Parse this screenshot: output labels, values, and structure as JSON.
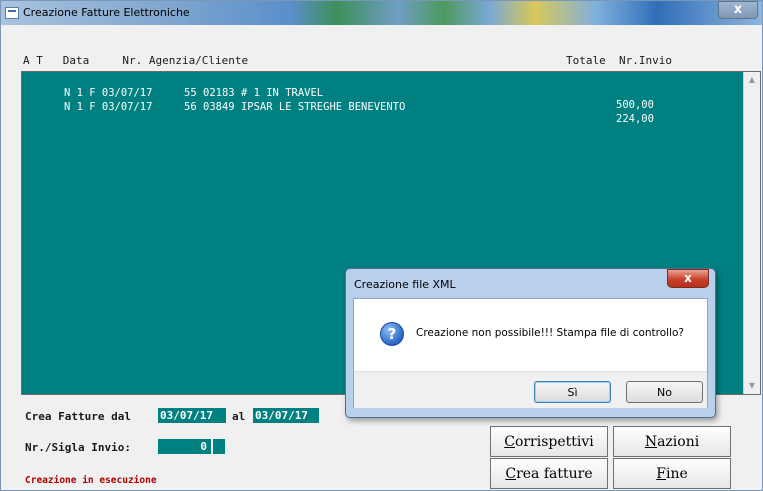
{
  "window": {
    "title": "Creazione Fatture Elettroniche",
    "close_glyph": "x"
  },
  "list": {
    "header": "A T   Data     Nr. Agenzia/Cliente                                                Totale  Nr.Invio",
    "rows": [
      {
        "text": "N 1 F 03/07/17     55 02183 # 1 IN TRAVEL",
        "total": "500,00"
      },
      {
        "text": "N 1 F 03/07/17     56 03849 IPSAR LE STREGHE BENEVENTO",
        "total": "224,00"
      }
    ],
    "scroll_up_glyph": "▲",
    "scroll_down_glyph": "▼"
  },
  "form": {
    "crea_label": "Crea Fatture dal",
    "date_from": "03/07/17",
    "al_label": "al",
    "date_to": "03/07/17",
    "invio_label": "Nr./Sigla Invio:",
    "invio_number": "0",
    "status": "Creazione in esecuzione"
  },
  "buttons": {
    "corrispettivi": {
      "first": "C",
      "rest": "orrispettivi"
    },
    "nazioni": {
      "first": "N",
      "rest": "azioni"
    },
    "crea_fatture": {
      "first": "C",
      "rest": "rea fatture"
    },
    "fine": {
      "first": "F",
      "rest": "ine"
    }
  },
  "dialog": {
    "title": "Creazione file XML",
    "close_glyph": "x",
    "icon": "question-icon",
    "icon_glyph": "?",
    "message": "Creazione non possibile!!! Stampa file di controllo?",
    "yes": "Sì",
    "no": "No"
  }
}
